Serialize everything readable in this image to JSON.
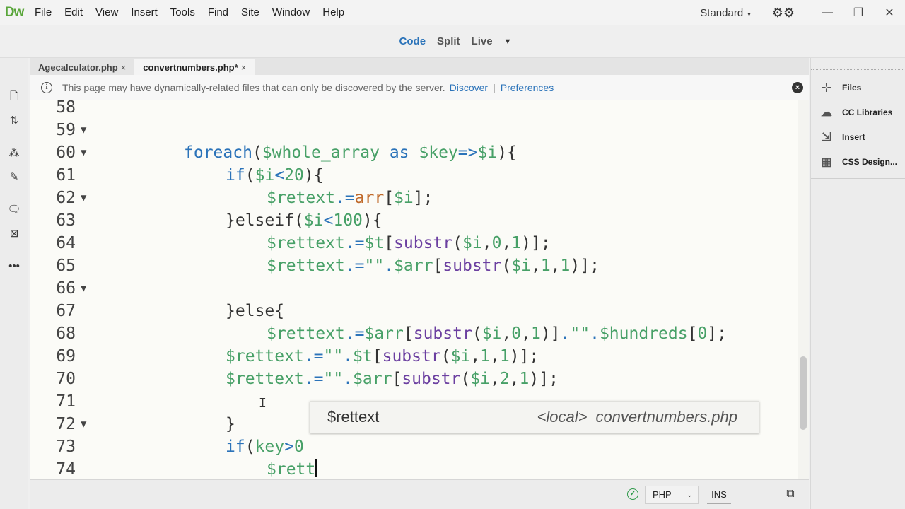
{
  "app": {
    "logo": "Dw"
  },
  "menu": [
    "File",
    "Edit",
    "View",
    "Insert",
    "Tools",
    "Find",
    "Site",
    "Window",
    "Help"
  ],
  "workspace": {
    "label": "Standard",
    "caret": "▾"
  },
  "window_controls": {
    "minimize": "—",
    "restore": "❐",
    "close": "✕"
  },
  "viewbar": {
    "code": "Code",
    "split": "Split",
    "live": "Live",
    "caret": "▼"
  },
  "tabs": [
    {
      "label": "Agecalculator.php",
      "close": "×"
    },
    {
      "label": "convertnumbers.php*",
      "close": "×"
    }
  ],
  "infobar": {
    "message": "This page may have dynamically-related files that can only be discovered by the server.",
    "discover": "Discover",
    "separator": "|",
    "preferences": "Preferences"
  },
  "code_lines": [
    {
      "num": "58",
      "fold": ""
    },
    {
      "num": "59",
      "fold": "▼"
    },
    {
      "num": "60",
      "fold": "▼"
    },
    {
      "num": "61",
      "fold": ""
    },
    {
      "num": "62",
      "fold": "▼"
    },
    {
      "num": "63",
      "fold": ""
    },
    {
      "num": "64",
      "fold": ""
    },
    {
      "num": "65",
      "fold": ""
    },
    {
      "num": "66",
      "fold": "▼"
    },
    {
      "num": "67",
      "fold": ""
    },
    {
      "num": "68",
      "fold": ""
    },
    {
      "num": "69",
      "fold": ""
    },
    {
      "num": "70",
      "fold": ""
    },
    {
      "num": "71",
      "fold": ""
    },
    {
      "num": "72",
      "fold": "▼"
    },
    {
      "num": "73",
      "fold": ""
    },
    {
      "num": "74",
      "fold": ""
    }
  ],
  "code_tokens": {
    "l59": [
      "foreach",
      "(",
      "$whole_array",
      " ",
      "as",
      " ",
      "$key",
      "=>",
      "$i",
      "){"
    ],
    "l60": [
      "if",
      "(",
      "$i",
      "<",
      "20",
      "){"
    ],
    "l61": [
      "$retext",
      ".=",
      "arr",
      "[",
      "$i",
      "];"
    ],
    "l62": [
      "}elseif",
      "(",
      "$i",
      "<",
      "100",
      "){"
    ],
    "l63": [
      "$rettext",
      ".=",
      "$t",
      "[",
      "substr",
      "(",
      "$i",
      ",",
      "0",
      ",",
      "1",
      ")];"
    ],
    "l64": [
      "$rettext",
      ".=",
      "\"\"",
      ".",
      "$arr",
      "[",
      "substr",
      "(",
      "$i",
      ",",
      "1",
      ",",
      "1",
      ")];"
    ],
    "l66": [
      "}else{"
    ],
    "l67": [
      "$rettext",
      ".=",
      "$arr",
      "[",
      "substr",
      "(",
      "$i",
      ",",
      "0",
      ",",
      "1",
      ")]",
      ".",
      "\"\"",
      ".",
      "$hundreds",
      "[",
      "0",
      "];"
    ],
    "l68": [
      "$rettext",
      ".=",
      "\"\"",
      ".",
      "$t",
      "[",
      "substr",
      "(",
      "$i",
      ",",
      "1",
      ",",
      "1",
      ")];"
    ],
    "l69": [
      "$rettext",
      ".=",
      "\"\"",
      ".",
      "$arr",
      "[",
      "substr",
      "(",
      "$i",
      ",",
      "2",
      ",",
      "1",
      ")];"
    ],
    "l71": [
      "}"
    ],
    "l72": [
      "if",
      "(",
      "key",
      ">",
      "0"
    ],
    "l73": [
      "$rett"
    ],
    "l74": [
      "}"
    ]
  },
  "autocomplete": {
    "name": "$rettext",
    "scope": "<local>",
    "file": "convertnumbers.php"
  },
  "right_panel": [
    "Files",
    "CC Libraries",
    "Insert",
    "CSS Design..."
  ],
  "status": {
    "language": "PHP",
    "mode": "INS"
  }
}
